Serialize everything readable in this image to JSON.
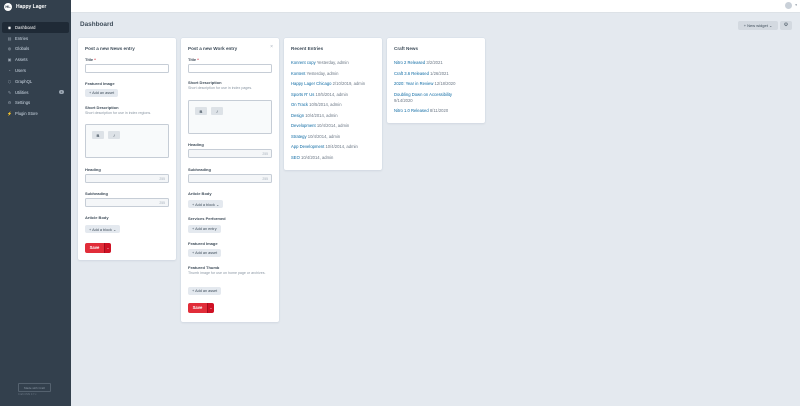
{
  "brand": {
    "name": "Happy Lager",
    "logo_letters": "HL"
  },
  "nav": [
    {
      "label": "Dashboard",
      "icon": "gauge-icon",
      "glyph": "◉"
    },
    {
      "label": "Entries",
      "icon": "newspaper-icon",
      "glyph": "▤"
    },
    {
      "label": "Globals",
      "icon": "globe-icon",
      "glyph": "◍"
    },
    {
      "label": "Assets",
      "icon": "image-icon",
      "glyph": "▣"
    },
    {
      "label": "Users",
      "icon": "users-icon",
      "glyph": "◔"
    },
    {
      "label": "GraphQL",
      "icon": "graphql-icon",
      "glyph": "⬡"
    },
    {
      "label": "Utilities",
      "icon": "wrench-icon",
      "glyph": "✎",
      "badge": "1"
    },
    {
      "label": "Settings",
      "icon": "gear-icon",
      "glyph": "⚙"
    },
    {
      "label": "Plugin Store",
      "icon": "plug-icon",
      "glyph": "⚡"
    }
  ],
  "sidebar_footer": {
    "made_with": "Made with Craft",
    "text": "Craft CMS 3.7.x"
  },
  "header": {
    "user_caret": "▾"
  },
  "page": {
    "title": "Dashboard",
    "new_widget": "+ New widget ⌄",
    "gear": "⚙"
  },
  "news_form": {
    "title": "Post a new News entry",
    "title_label": "Title",
    "required_mark": "*",
    "featured_image_label": "Featured Image",
    "add_asset": "+ Add an asset",
    "short_desc_label": "Short Description",
    "short_desc_help": "Short description for use in index regions.",
    "bold": "B",
    "italic": "I",
    "heading_label": "Heading",
    "heading_count": "255",
    "subheading_label": "Subheading",
    "subheading_count": "255",
    "article_body_label": "Article Body",
    "add_block": "+ Add a block ⌄",
    "save": "Save",
    "save_menu": "⌄"
  },
  "work_form": {
    "title": "Post a new Work entry",
    "close": "×",
    "title_label": "Title",
    "required_mark": "*",
    "short_desc_label": "Short Description",
    "short_desc_help": "Short description for use in index pages.",
    "bold": "B",
    "italic": "I",
    "heading_label": "Heading",
    "heading_count": "255",
    "subheading_label": "Subheading",
    "subheading_count": "255",
    "article_body_label": "Article Body",
    "add_block": "+ Add a block ⌄",
    "services_label": "Services Performed",
    "add_entry": "+ Add an entry",
    "featured_image_label": "Featured Image",
    "add_asset_1": "+ Add an asset",
    "featured_thumb_label": "Featured Thumb",
    "featured_thumb_help": "Thumb image for use on home page or archives.",
    "add_asset_2": "+ Add an asset",
    "save": "Save",
    "save_menu": "⌄"
  },
  "recent_entries": {
    "title": "Recent Entries",
    "items": [
      {
        "title": "Konrent copy",
        "meta": " Yesterday, admin"
      },
      {
        "title": "Kontent",
        "meta": " Yesterday, admin"
      },
      {
        "title": "Happy Lager Chicago",
        "meta": " 2/10/2019, admin"
      },
      {
        "title": "Sports R' Us",
        "meta": " 10/5/2014, admin"
      },
      {
        "title": "On Track",
        "meta": " 10/5/2014, admin"
      },
      {
        "title": "Design",
        "meta": " 10/4/2014, admin"
      },
      {
        "title": "Development",
        "meta": " 10/4/2014, admin"
      },
      {
        "title": "Strategy",
        "meta": " 10/4/2014, admin"
      },
      {
        "title": "App Development",
        "meta": " 10/4/2014, admin"
      },
      {
        "title": "SEO",
        "meta": " 10/4/2014, admin"
      }
    ]
  },
  "craft_news": {
    "title": "Craft News",
    "items": [
      {
        "title": "Nitro 2 Released",
        "date": " 3/2/2021"
      },
      {
        "title": "Craft 3.6 Released",
        "date": " 1/26/2021"
      },
      {
        "title": "2020: Year in Review",
        "date": " 12/18/2020"
      },
      {
        "title": "Doubling Down on Accessibility",
        "date": "9/14/2020"
      },
      {
        "title": "Nitro 1.0 Released",
        "date": " 8/11/2020"
      }
    ]
  }
}
